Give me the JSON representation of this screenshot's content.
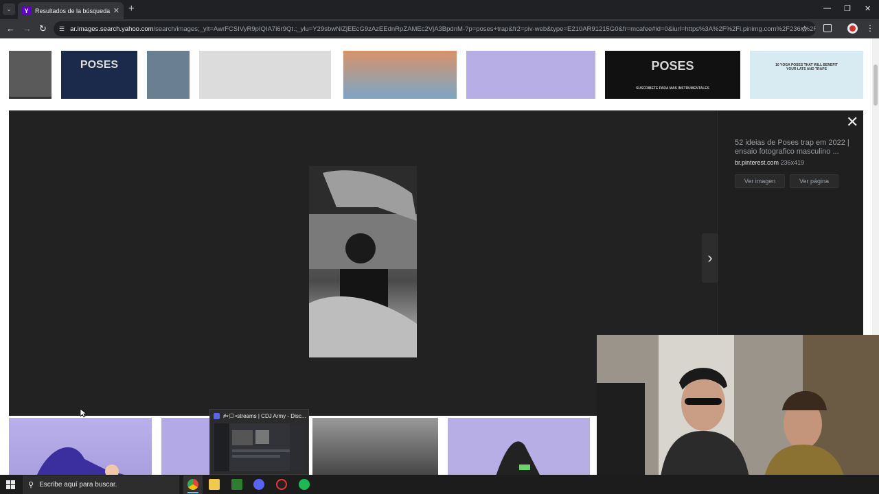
{
  "browser": {
    "tab_title": "Resultados de la búsqueda de imágenes",
    "tab_favicon_letter": "Y",
    "new_tab_glyph": "+",
    "url_host": "ar.images.search.yahoo.com",
    "url_rest": "/search/images;_ylt=AwrFCSIVyR9pIQIA7i6r9Qt.;_ylu=Y29sbwNiZjEEcG9zAzEEdnRpZAMEc2VjA3BpdnM-?p=poses+trap&fr2=piv-web&type=E210AR91215G0&fr=mcafee#id=0&iurl=https%3A%2F%2Fi.pinimg.com%2F236x%2F..."
  },
  "thumbnails_top": [
    {
      "name": "thumb-1",
      "color": "#555555"
    },
    {
      "name": "thumb-poses-1",
      "color": "#1b2a4a",
      "caption": "POSES"
    },
    {
      "name": "thumb-3",
      "color": "#6a7f92"
    },
    {
      "name": "thumb-muscles",
      "color": "#d9d9d9"
    },
    {
      "name": "thumb-yoga-mat",
      "color": "#c98a66"
    },
    {
      "name": "thumb-yoga-purple",
      "color": "#b7aee6"
    },
    {
      "name": "thumb-poses-2",
      "color": "#111111",
      "caption": "POSES",
      "subcaption": "SUSCRIBETE PARA MAS INSTRUMENTALES"
    },
    {
      "name": "thumb-yoga-lats",
      "color": "#d8eaf2",
      "caption": "10 YOGA POSES THAT WILL BENEFIT YOUR LATS AND TRAPS"
    }
  ],
  "viewer": {
    "title": "52 ideias de Poses trap em 2022 | ensaio fotografico masculino ...",
    "domain": "br.pinterest.com",
    "dimensions": "236x419",
    "btn_view_image": "Ver imagen",
    "btn_view_page": "Ver página",
    "close_glyph": "✕",
    "next_glyph": "›"
  },
  "preview": {
    "title": "#•🗯•streams | CDJ Army - Disc..."
  },
  "taskbar": {
    "search_placeholder": "Escribe aquí para buscar."
  }
}
